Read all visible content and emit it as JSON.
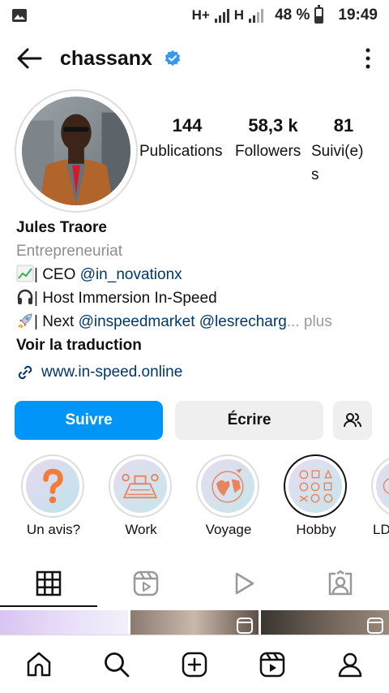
{
  "status_bar": {
    "network1": "H+",
    "network2": "H",
    "battery": "48 %",
    "time": "19:49"
  },
  "header": {
    "username": "chassanx"
  },
  "stats": {
    "posts_count": "144",
    "posts_label": "Publications",
    "followers_count": "58,3 k",
    "followers_label": "Followers",
    "following_count": "81",
    "following_label": "Suivi(e)s"
  },
  "bio": {
    "name": "Jules Traore",
    "category": "Entrepreneuriat",
    "line1_text": "| CEO ",
    "line1_mention": "@in_novationx",
    "line2_text": "| Host Immersion In-Speed",
    "line3_text": "| Next ",
    "line3_mention1": "@inspeedmarket",
    "line3_mention2": "@lesrecharg",
    "line3_ellipsis": "...",
    "line3_more": " plus",
    "translate": "Voir la traduction",
    "website": "www.in-speed.online"
  },
  "actions": {
    "follow_label": "Suivre",
    "message_label": "Écrire"
  },
  "highlights": [
    {
      "label": "Un avis?"
    },
    {
      "label": "Work"
    },
    {
      "label": "Voyage"
    },
    {
      "label": "Hobby"
    },
    {
      "label": "LD"
    }
  ],
  "colors": {
    "accent": "#0095f6",
    "link": "#00376b",
    "verified": "#3897f0"
  }
}
